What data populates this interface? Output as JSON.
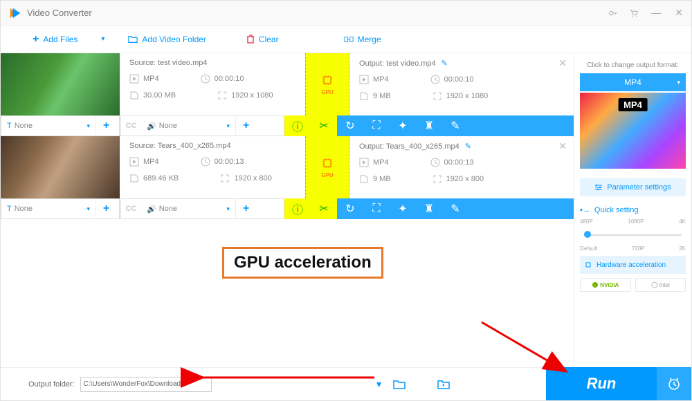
{
  "app": {
    "title": "Video Converter"
  },
  "toolbar": {
    "add_files": "Add Files",
    "add_folder": "Add Video Folder",
    "clear": "Clear",
    "merge": "Merge"
  },
  "items": [
    {
      "source_label": "Source: test video.mp4",
      "output_label": "Output: test video.mp4",
      "src": {
        "format": "MP4",
        "duration": "00:00:10",
        "size": "30.00 MB",
        "res": "1920 x 1080"
      },
      "out": {
        "format": "MP4",
        "duration": "00:00:10",
        "size": "9 MB",
        "res": "1920 x 1080"
      },
      "subtitle": "None",
      "audio": "None",
      "gpu": "GPU"
    },
    {
      "source_label": "Source: Tears_400_x265.mp4",
      "output_label": "Output: Tears_400_x265.mp4",
      "src": {
        "format": "MP4",
        "duration": "00:00:13",
        "size": "689.46 KB",
        "res": "1920 x 800"
      },
      "out": {
        "format": "MP4",
        "duration": "00:00:13",
        "size": "9 MB",
        "res": "1920 x 800"
      },
      "subtitle": "None",
      "audio": "None",
      "gpu": "GPU"
    }
  ],
  "annotation": "GPU acceleration",
  "right": {
    "change_format": "Click to change output format:",
    "format": "MP4",
    "format_badge": "MP4",
    "params": "Parameter settings",
    "quick": "Quick setting",
    "ticks_top": [
      "480P",
      "1080P",
      "4K"
    ],
    "ticks_bot": [
      "Default",
      "720P",
      "2K"
    ],
    "hw": "Hardware acceleration",
    "nvidia": "NVIDIA",
    "intel": "Intel"
  },
  "bottom": {
    "label": "Output folder:",
    "path": "C:\\Users\\WonderFox\\Downloads",
    "run": "Run"
  }
}
